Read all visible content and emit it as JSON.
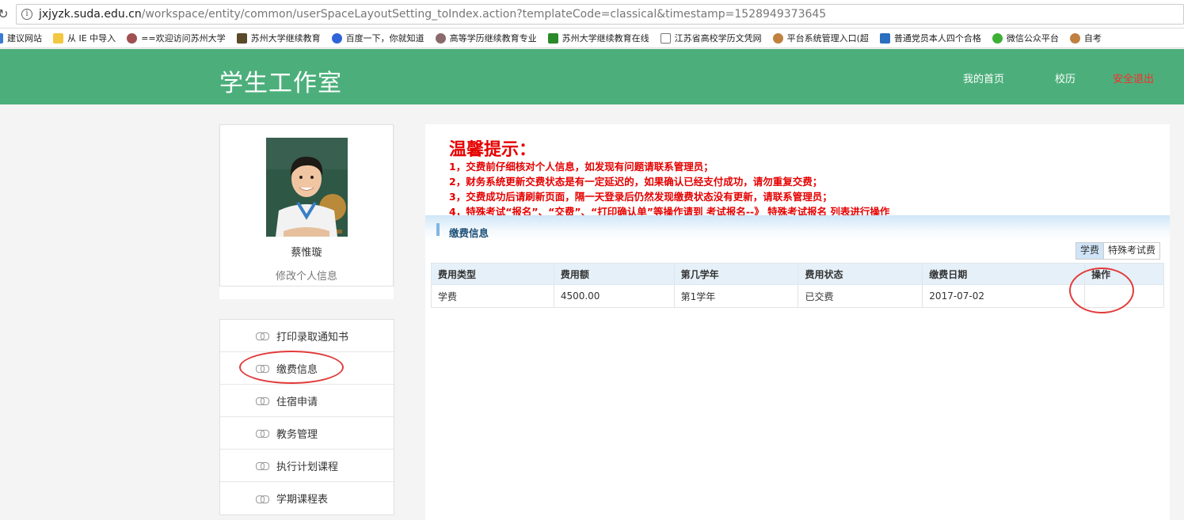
{
  "browser": {
    "url_host": "jxjyzk.suda.edu.cn",
    "url_path": "/workspace/entity/common/userSpaceLayoutSetting_toIndex.action?templateCode=classical&timestamp=1528949373645",
    "bookmarks": [
      {
        "label": "建议网站",
        "color": "#3a7bd5"
      },
      {
        "label": "从 IE 中导入",
        "color": "#f3c742"
      },
      {
        "label": "==欢迎访问苏州大学",
        "color": "#a05050"
      },
      {
        "label": "苏州大学继续教育",
        "color": "#5a4a2a"
      },
      {
        "label": "百度一下，你就知道",
        "color": "#2f64d8"
      },
      {
        "label": "高等学历继续教育专业",
        "color": "#8a6a6a"
      },
      {
        "label": "苏州大学继续教育在线",
        "color": "#2a8a2a"
      },
      {
        "label": "江苏省高校学历文凭网",
        "color": "#ffffff"
      },
      {
        "label": "平台系统管理入口(超",
        "color": "#c08040"
      },
      {
        "label": "普通党员本人四个合格",
        "color": "#2a6fc0"
      },
      {
        "label": "微信公众平台",
        "color": "#3cb034"
      },
      {
        "label": "自考",
        "color": "#c08040"
      }
    ]
  },
  "header": {
    "title": "学生工作室",
    "nav": {
      "home": "我的首页",
      "calendar": "校历",
      "logout": "安全退出"
    }
  },
  "profile": {
    "name": "蔡惟璇",
    "edit": "修改个人信息"
  },
  "menu": [
    {
      "label": "打印录取通知书"
    },
    {
      "label": "缴费信息"
    },
    {
      "label": "住宿申请"
    },
    {
      "label": "教务管理"
    },
    {
      "label": "执行计划课程"
    },
    {
      "label": "学期课程表"
    }
  ],
  "notice": {
    "title": "温馨提示：",
    "lines": [
      "1，交费前仔细核对个人信息，如发现有问题请联系管理员；",
      "2，财务系统更新交费状态是有一定延迟的，如果确认已经支付成功，请勿重复交费；",
      "3，交费成功后请刷新页面，隔一天登录后仍然发现缴费状态没有更新，请联系管理员；",
      "4，特殊考试“报名”、“交费”、“打印确认单”等操作请到 考试报名--》 特殊考试报名 列表进行操作"
    ]
  },
  "section": {
    "title": "缴费信息"
  },
  "tabs": [
    {
      "label": "学费"
    },
    {
      "label": "特殊考试费"
    }
  ],
  "table": {
    "headers": [
      "费用类型",
      "费用额",
      "第几学年",
      "费用状态",
      "缴费日期",
      "操作"
    ],
    "rows": [
      [
        "学费",
        "4500.00",
        "第1学年",
        "已交费",
        "2017-07-02",
        ""
      ]
    ]
  },
  "colors": {
    "header_green": "#4caf7b",
    "notice_red": "#e50000",
    "annotation_red": "#e23b3b"
  }
}
